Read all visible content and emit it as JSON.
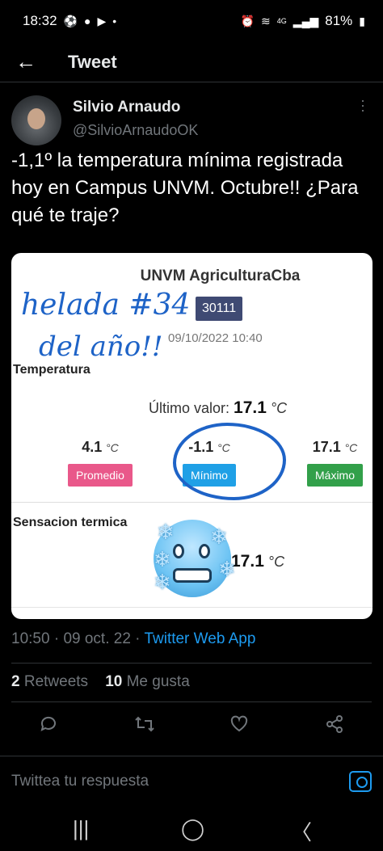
{
  "status_bar": {
    "time": "18:32",
    "left_icons": [
      "soccer-ball-icon",
      "facebook-icon",
      "youtube-icon",
      "dot-icon"
    ],
    "right_icons": [
      "alarm-icon",
      "alarm-clock-icon",
      "wifi-icon",
      "signal-icon",
      "battery-icon"
    ],
    "network": "4G",
    "battery": "81%"
  },
  "header": {
    "title": "Tweet",
    "back_icon": "arrow-left-icon"
  },
  "author": {
    "display_name": "Silvio Arnaudo",
    "handle": "@SilvioArnaudoOK"
  },
  "tweet": {
    "text": "-1,1º la temperatura mínima registrada hoy en Campus UNVM. Octubre!! ¿Para qué te traje?"
  },
  "media": {
    "station": "UNVM AgriculturaCba",
    "handwritten_line1": "helada #34",
    "handwritten_line2": "del año!!",
    "station_id": "30111",
    "timestamp": "09/10/2022 10:40",
    "temperature_label": "Temperatura",
    "last_value_label": "Último valor:",
    "last_value": "17.1",
    "unit": "°C",
    "promedio_value": "4.1",
    "promedio_label": "Promedio",
    "minimo_value": "-1.1",
    "minimo_label": "Mínimo",
    "maximo_value": "17.1",
    "maximo_label": "Máximo",
    "sensation_label": "Sensacion termica",
    "sensation_value": "17.1",
    "emoji": "freezing-face-emoji"
  },
  "meta": {
    "time": "10:50",
    "date": "09 oct. 22",
    "app": "Twitter Web App"
  },
  "stats": {
    "retweets_count": "2",
    "retweets_label": "Retweets",
    "likes_count": "10",
    "likes_label": "Me gusta"
  },
  "actions": [
    "reply-icon",
    "retweet-icon",
    "like-icon",
    "share-icon"
  ],
  "reply_box": {
    "placeholder": "Twittea tu respuesta"
  },
  "accent_color": "#1d9bf0"
}
